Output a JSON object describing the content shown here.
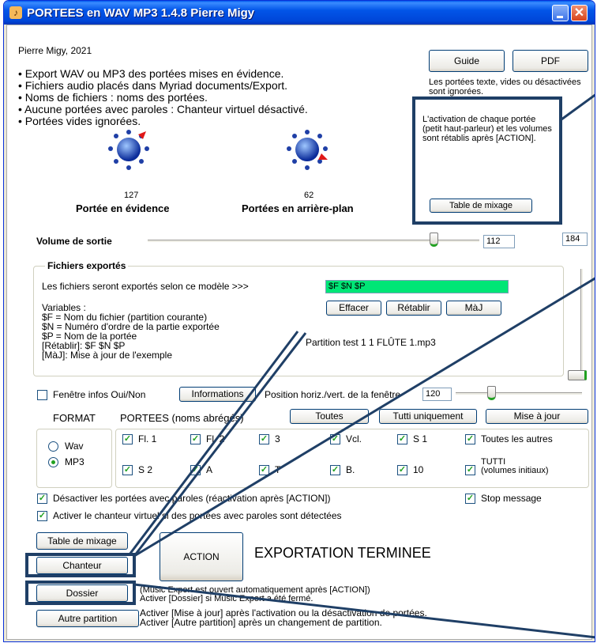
{
  "window": {
    "title": "PORTEES en WAV MP3 1.4.8 Pierre Migy",
    "close_glyph": "✕"
  },
  "header": {
    "author": "Pierre Migy, 2021",
    "bullets": [
      "• Export WAV ou MP3 des portées mises en évidence.",
      "• Fichiers audio placés dans Myriad documents/Export.",
      "• Noms de fichiers : noms des portées.",
      "• Aucune portées avec paroles : Chanteur virtuel désactivé.",
      "• Portées vides ignorées."
    ]
  },
  "buttons": {
    "guide": "Guide",
    "pdf": "PDF",
    "table_mixage": "Table de mixage",
    "effacer": "Effacer",
    "retablir": "Rétablir",
    "maj": "MàJ",
    "informations": "Informations",
    "toutes": "Toutes",
    "tutti": "Tutti uniquement",
    "mise_a_jour": "Mise à jour",
    "table_mixage2": "Table de mixage",
    "chanteur": "Chanteur",
    "action": "ACTION",
    "dossier": "Dossier",
    "autre_partition": "Autre partition"
  },
  "notes": {
    "ignored": "Les portées texte, vides ou désactivées sont ignorées.",
    "activation": "L'activation de chaque portée (petit haut-parleur) et les volumes sont  rétablis après [ACTION]."
  },
  "spheres": [
    {
      "value": "127",
      "label": "Portée en évidence"
    },
    {
      "value": "62",
      "label": "Portées en arrière-plan"
    }
  ],
  "volume": {
    "label": "Volume de sortie",
    "value": "112",
    "right_value": "184",
    "level": 0.61
  },
  "export": {
    "title": "Fichiers exportés",
    "model_label": "Les fichiers seront exportés selon ce modèle >>>",
    "model_value": "$F $N $P",
    "variables": [
      "Variables :",
      "$F = Nom du fichier (partition courante)",
      "$N = Numéro d'ordre de la partie exportée",
      "$P = Nom de la portée",
      "[Rétablir]: $F $N $P",
      "[MàJ]: Mise à jour de l'exemple"
    ],
    "example": "Partition test 1 1 FLÛTE 1.mp3"
  },
  "infos": {
    "label": "Fenêtre infos Oui/Non",
    "position_label": "Position horiz./vert. de la fenêtre",
    "position_value": "120",
    "checked": false
  },
  "format": {
    "label": "FORMAT",
    "options": [
      "Wav",
      "MP3"
    ],
    "selected": "MP3"
  },
  "portees": {
    "label": "PORTEES (noms abrégés)",
    "row1": [
      "Fl. 1",
      "Fl. 2",
      "3",
      "Vcl.",
      "S 1",
      "Toutes les autres"
    ],
    "row2": [
      "S 2",
      "A",
      "T",
      "B.",
      "10",
      "TUTTI\n(volumes initiaux)"
    ]
  },
  "options": {
    "desactiver": "Désactiver les portées avec paroles (réactivation après [ACTION])",
    "activer": "Activer le chanteur virtuel si des portées avec paroles sont détectées",
    "stop": "Stop message"
  },
  "status": "EXPORTATION TERMINEE",
  "footer": {
    "dossier_note": [
      "(Music Export est ouvert automatiquement après [ACTION])",
      "Activer [Dossier] si Music Export a été fermé."
    ],
    "autre_note": [
      "Activer [Mise à jour] après l'activation ou la désactivation de portées.",
      "Activer [Autre partition] après un changement de partition."
    ]
  },
  "colors": {
    "title_blue": "#0054e3",
    "model_green": "#00e676",
    "annotation": "#1f3f66",
    "check_green": "#21a121"
  }
}
